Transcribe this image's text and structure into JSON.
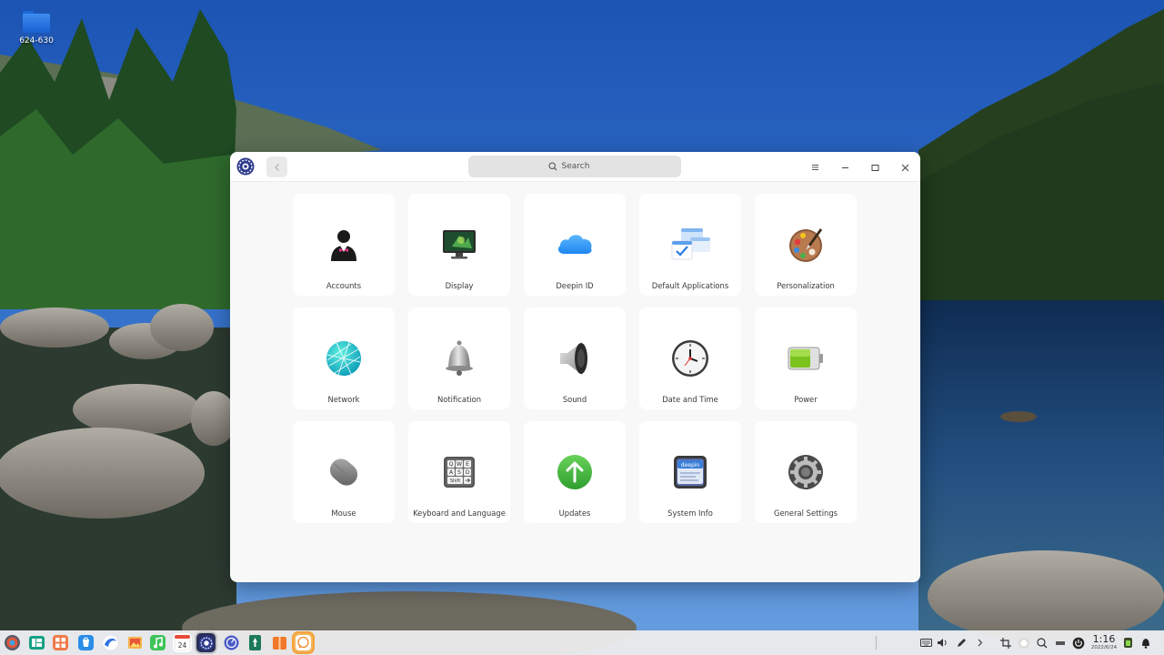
{
  "desktop": {
    "folder_label": "624-630"
  },
  "window": {
    "search_placeholder": "Search",
    "modules": [
      {
        "label": "Accounts",
        "icon": "accounts-icon"
      },
      {
        "label": "Display",
        "icon": "display-icon"
      },
      {
        "label": "Deepin ID",
        "icon": "cloud-icon"
      },
      {
        "label": "Default Applications",
        "icon": "default-apps-icon"
      },
      {
        "label": "Personalization",
        "icon": "palette-icon"
      },
      {
        "label": "Network",
        "icon": "globe-icon"
      },
      {
        "label": "Notification",
        "icon": "bell-icon"
      },
      {
        "label": "Sound",
        "icon": "speaker-icon"
      },
      {
        "label": "Date and Time",
        "icon": "clock-icon"
      },
      {
        "label": "Power",
        "icon": "battery-icon"
      },
      {
        "label": "Mouse",
        "icon": "mouse-icon"
      },
      {
        "label": "Keyboard and Language",
        "icon": "keyboard-icon"
      },
      {
        "label": "Updates",
        "icon": "update-arrow-icon"
      },
      {
        "label": "System Info",
        "icon": "system-info-icon"
      },
      {
        "label": "General Settings",
        "icon": "gear-icon"
      }
    ],
    "keyboard_keys": [
      "Q",
      "W",
      "E",
      "A",
      "S",
      "D",
      "Shift"
    ],
    "system_info_badge": "deepin"
  },
  "taskbar": {
    "calendar_day": "24",
    "clock_time": "1:16",
    "clock_date": "2022/6/24"
  },
  "colors": {
    "accent": "#2c7be5",
    "update_green": "#3fb33a",
    "battery_green": "#7ac21c"
  }
}
